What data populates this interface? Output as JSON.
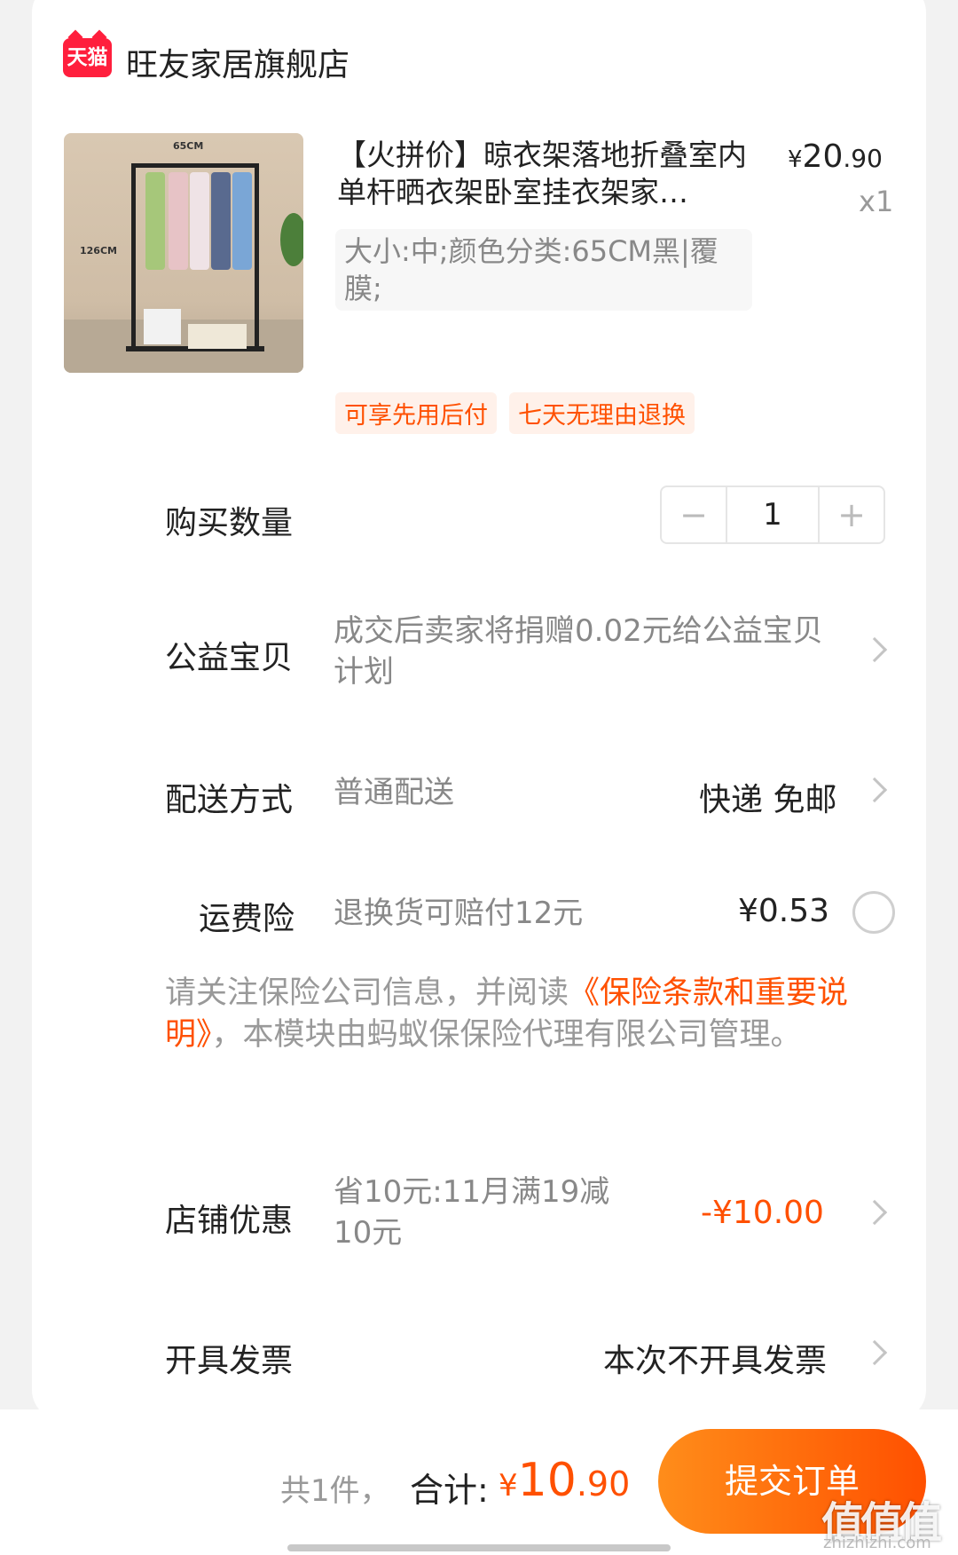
{
  "shop": {
    "logo_text": "天猫",
    "name": "旺友家居旗舰店"
  },
  "product": {
    "image_labels": {
      "width": "65CM",
      "height": "126CM"
    },
    "title": "【火拼价】晾衣架落地折叠室内单杆晒衣架卧室挂衣架家…",
    "price_symbol": "¥",
    "price_int": "20",
    "price_dec": ".90",
    "quantity": "x1",
    "sku": "大小:中;颜色分类:65CM黑|覆膜;",
    "tags": [
      "可享先用后付",
      "七天无理由退换"
    ]
  },
  "quantity_row": {
    "label": "购买数量",
    "minus": "−",
    "value": "1",
    "plus": "+"
  },
  "charity_row": {
    "label": "公益宝贝",
    "value": "成交后卖家将捐赠0.02元给公益宝贝计划"
  },
  "delivery_row": {
    "label": "配送方式",
    "value": "普通配送",
    "right": "快递 免邮"
  },
  "insurance_row": {
    "label": "运费险",
    "value": "退换货可赔付12元",
    "price": "¥0.53",
    "selected": false
  },
  "insurance_notice": {
    "prefix": "请关注保险公司信息，并阅读",
    "link": "《保险条款和重要说明》",
    "suffix": "，本模块由蚂蚁保保险代理有限公司管理。"
  },
  "discount_row": {
    "label": "店铺优惠",
    "value": "省10元:11月满19减10元",
    "amount": "-¥10.00"
  },
  "invoice_row": {
    "label": "开具发票",
    "right": "本次不开具发票"
  },
  "footer": {
    "count": "共1件，",
    "total_label": "合计:",
    "total_symbol": "¥",
    "total_int": "10",
    "total_dec": ".90",
    "submit": "提交订单",
    "watermark": "值值值",
    "watermark_url": "zhizhizhi.com"
  },
  "colors": {
    "accent": "#ff5000",
    "brand_tmall": "#ff1f3d",
    "button_gradient_start": "#ff8d1a"
  }
}
